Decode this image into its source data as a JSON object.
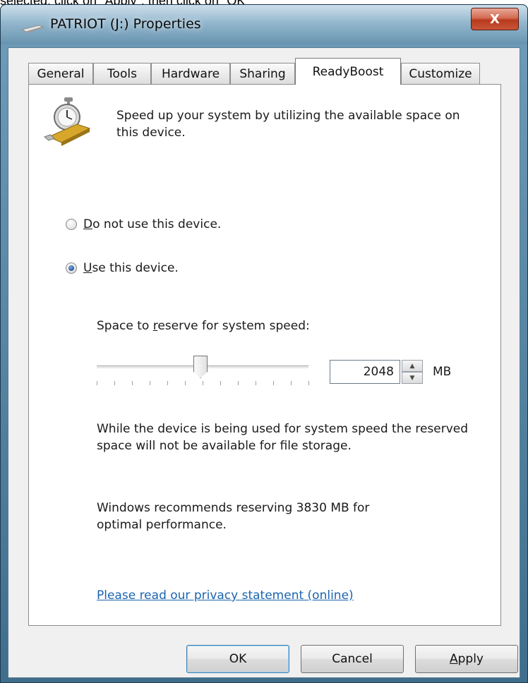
{
  "caption": "selected, click on \"Apply\", then click on \"OK\"",
  "window": {
    "title": "PATRIOT (J:) Properties",
    "close_label": "X"
  },
  "tabs": [
    {
      "label": "General"
    },
    {
      "label": "Tools"
    },
    {
      "label": "Hardware"
    },
    {
      "label": "Sharing"
    },
    {
      "label": "ReadyBoost",
      "active": true
    },
    {
      "label": "Customize"
    }
  ],
  "readyboost": {
    "description": "Speed up your system by utilizing the available space on this device.",
    "radio_do_not_use": {
      "accel": "D",
      "rest": "o not use this device.",
      "checked": false
    },
    "radio_use": {
      "accel": "U",
      "rest": "se this device.",
      "checked": true
    },
    "reserve_label": {
      "before": "Space to ",
      "accel": "r",
      "after": "eserve for system speed:"
    },
    "slider_fraction": 0.49,
    "reserve_value": "2048",
    "unit": "MB",
    "storage_note": "While the device is being used for system speed the reserved space will not be available for file storage.",
    "recommendation": "Windows recommends reserving 3830 MB for optimal performance.",
    "privacy_link": "Please read our privacy statement (online)"
  },
  "buttons": {
    "ok": "OK",
    "cancel": "Cancel",
    "apply_accel": "A",
    "apply_rest": "pply"
  },
  "icons": {
    "drive": "usb-drive-icon",
    "readyboost": "readyboost-stopwatch-icon"
  },
  "colors": {
    "link": "#1a64b0",
    "close_button": "#c9553a",
    "frame": "#3f6e8d"
  }
}
